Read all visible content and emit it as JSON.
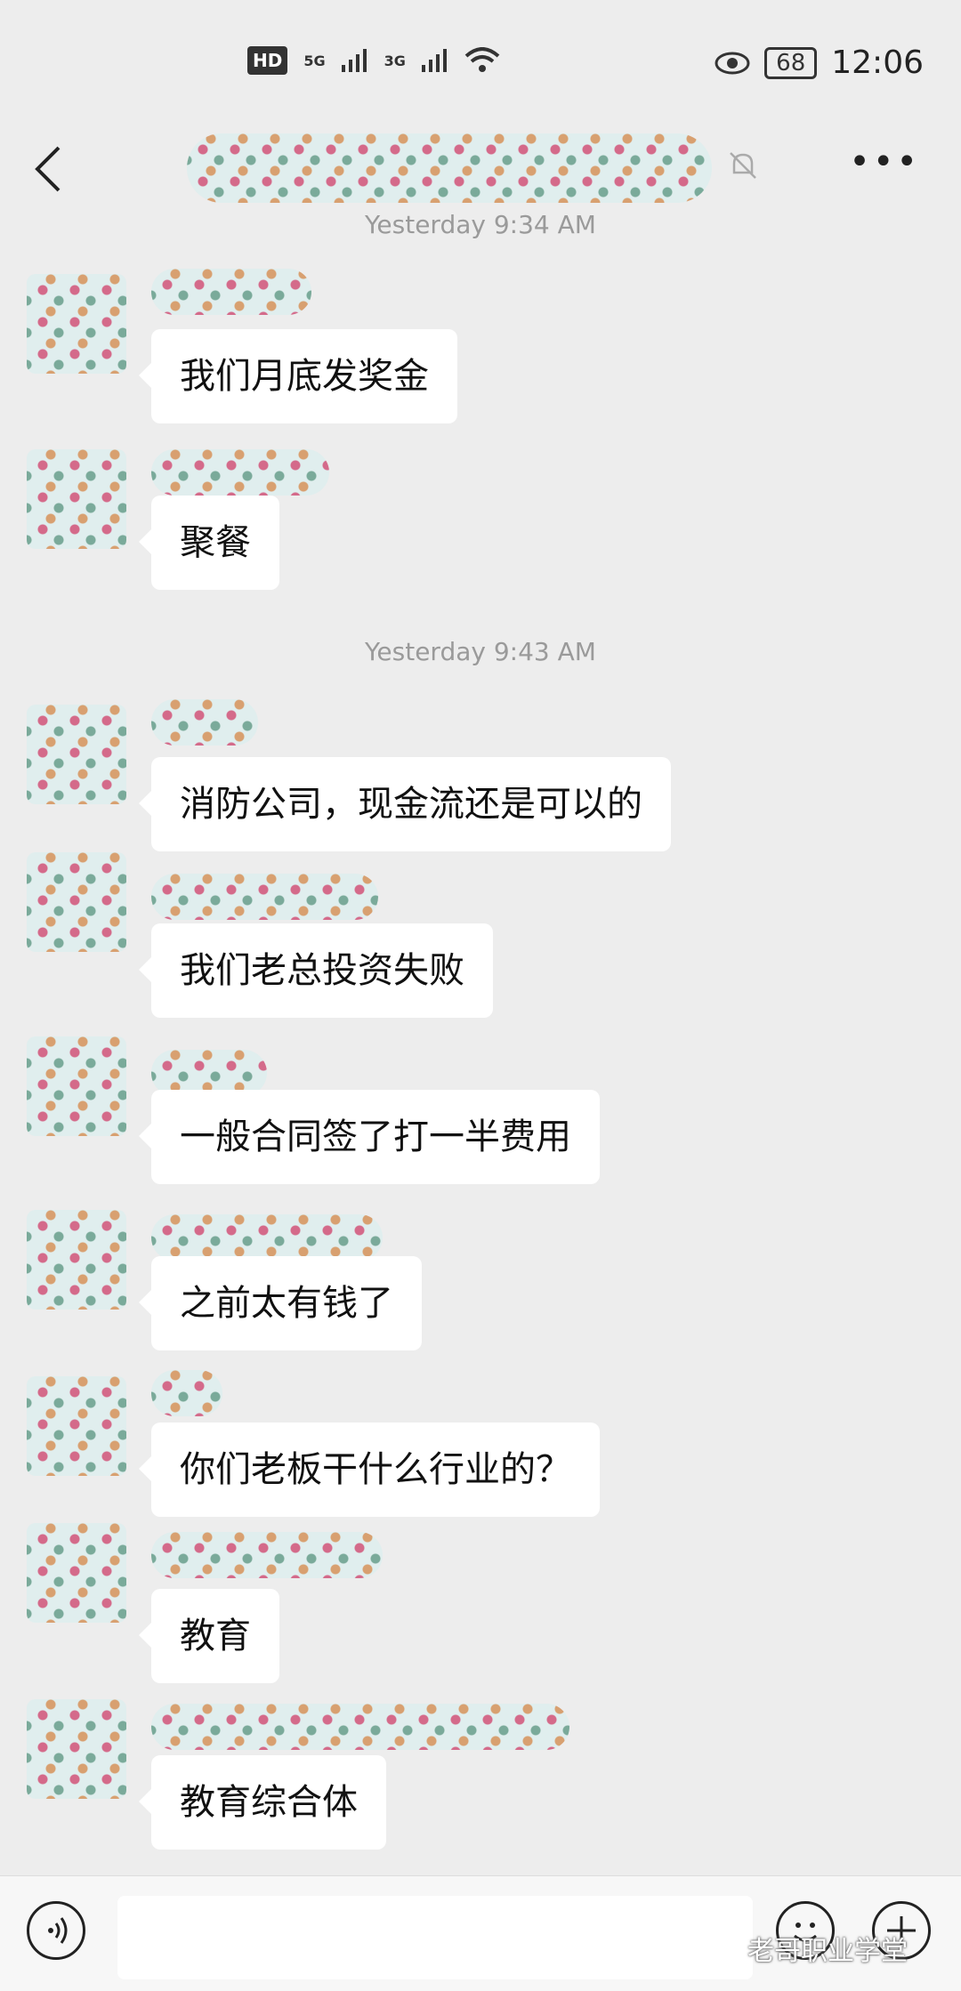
{
  "status_bar": {
    "hd": "HD",
    "net1": "5G",
    "net2": "3G",
    "battery": "68",
    "time": "12:06"
  },
  "header": {
    "back_icon": "chevron-left-icon",
    "mute_icon": "bell-off-icon",
    "more_icon": "more-dots-icon"
  },
  "chat": {
    "timestamps": [
      "Yesterday 9:34 AM",
      "Yesterday 9:43 AM"
    ],
    "messages": [
      {
        "text": "我们月底发奖金"
      },
      {
        "text": "聚餐"
      },
      {
        "text": "消防公司，现金流还是可以的"
      },
      {
        "text": "我们老总投资失败"
      },
      {
        "text": "一般合同签了打一半费用"
      },
      {
        "text": "之前太有钱了"
      },
      {
        "text": "你们老板干什么行业的？"
      },
      {
        "text": "教育"
      },
      {
        "text": "教育综合体"
      }
    ]
  },
  "input_bar": {
    "voice_icon": "voice-icon",
    "emoji_icon": "emoji-icon",
    "plus_icon": "plus-icon",
    "input_value": ""
  },
  "watermark": "老哥职业学堂"
}
